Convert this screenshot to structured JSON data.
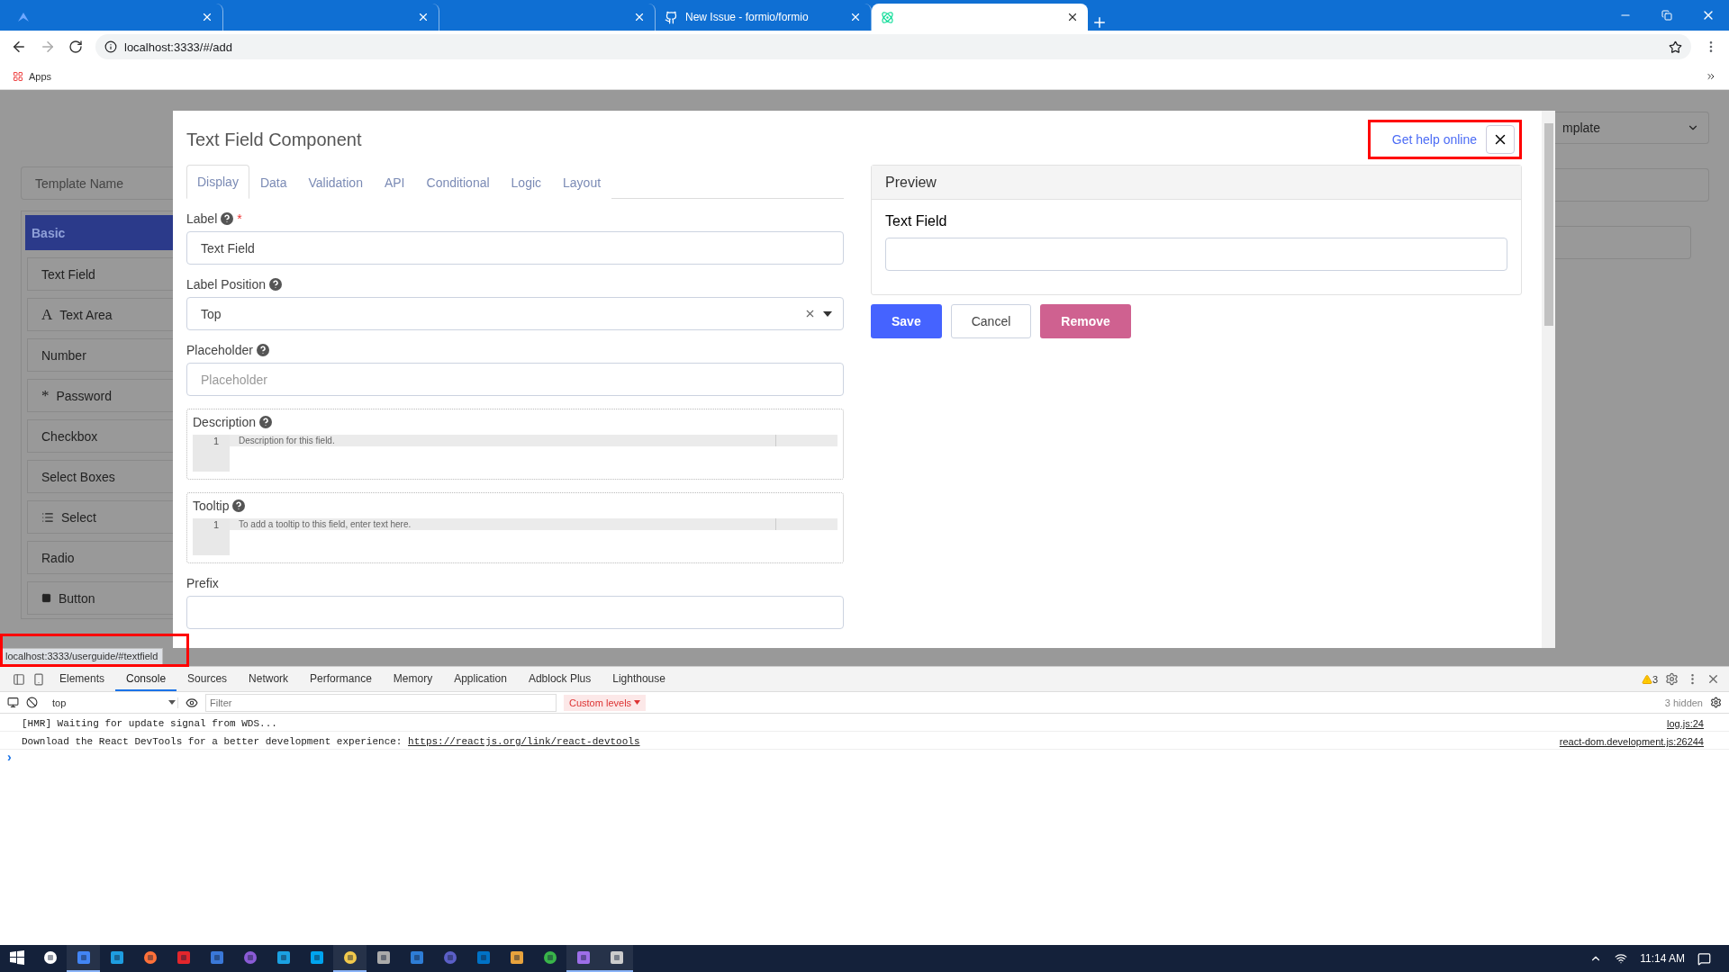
{
  "browser": {
    "tabs": [
      {
        "selected": false
      },
      {
        "selected": false
      },
      {
        "selected": false
      },
      {
        "title": "New Issue - formio/formio",
        "selected": false
      },
      {
        "selected": true
      }
    ],
    "address": "localhost:3333/#/add",
    "bookmarks": [
      "Apps"
    ]
  },
  "page": {
    "template_name_placeholder": "Template Name",
    "template_select": "mplate",
    "sidebar": {
      "group": "Basic",
      "items": [
        {
          "label": "Text Field",
          "kind": "plain"
        },
        {
          "label": "Text Area",
          "kind": "glyph",
          "glyph": "A"
        },
        {
          "label": "Number",
          "kind": "plain"
        },
        {
          "label": "Password",
          "kind": "glyph",
          "glyph": "*"
        },
        {
          "label": "Checkbox",
          "kind": "plain"
        },
        {
          "label": "Select Boxes",
          "kind": "plain"
        },
        {
          "label": "Select",
          "kind": "list"
        },
        {
          "label": "Radio",
          "kind": "plain"
        },
        {
          "label": "Button",
          "kind": "stop"
        }
      ]
    }
  },
  "modal": {
    "title": "Text Field Component",
    "help_link": "Get help online",
    "tabs": [
      {
        "label": "Display",
        "selected": true
      },
      {
        "label": "Data",
        "selected": false
      },
      {
        "label": "Validation",
        "selected": false
      },
      {
        "label": "API",
        "selected": false
      },
      {
        "label": "Conditional",
        "selected": false
      },
      {
        "label": "Logic",
        "selected": false
      },
      {
        "label": "Layout",
        "selected": false
      }
    ],
    "fields": [
      {
        "kind": "input",
        "label": "Label",
        "help": true,
        "required_mark": "*",
        "value": "Text Field"
      },
      {
        "kind": "select",
        "label": "Label Position",
        "help": true,
        "value": "Top"
      },
      {
        "kind": "input",
        "label": "Placeholder",
        "help": true,
        "placeholder": "Placeholder"
      },
      {
        "kind": "editor",
        "label": "Description",
        "help": true,
        "line": "1",
        "placeholder": "Description for this field."
      },
      {
        "kind": "editor",
        "label": "Tooltip",
        "help": true,
        "line": "1",
        "placeholder": "To add a tooltip to this field, enter text here."
      },
      {
        "kind": "input",
        "label": "Prefix",
        "help": false
      }
    ],
    "preview": {
      "title": "Preview",
      "label": "Text Field"
    },
    "buttons": [
      {
        "label": "Save",
        "kind": "primary"
      },
      {
        "label": "Cancel",
        "kind": "secondary"
      },
      {
        "label": "Remove",
        "kind": "danger"
      }
    ]
  },
  "status_url": "localhost:3333/userguide/#textfield",
  "devtools": {
    "tabs": [
      {
        "label": "Elements",
        "selected": false
      },
      {
        "label": "Console",
        "selected": true
      },
      {
        "label": "Sources",
        "selected": false
      },
      {
        "label": "Network",
        "selected": false
      },
      {
        "label": "Performance",
        "selected": false
      },
      {
        "label": "Memory",
        "selected": false
      },
      {
        "label": "Application",
        "selected": false
      },
      {
        "label": "Adblock Plus",
        "selected": false
      },
      {
        "label": "Lighthouse",
        "selected": false
      }
    ],
    "warnings": "3",
    "context": "top",
    "filter_placeholder": "Filter",
    "levels": "Custom levels",
    "hidden": "3 hidden",
    "messages": [
      {
        "text": "[HMR] Waiting for update signal from WDS...",
        "source": "log.js:24"
      },
      {
        "text": "Download the React DevTools for a better development experience: ",
        "link": "https://reactjs.org/link/react-devtools",
        "source": "react-dom.development.js:26244"
      }
    ],
    "prompt": "›"
  },
  "taskbar": {
    "apps": [
      {
        "running": false
      },
      {
        "running": true
      },
      {
        "running": false
      },
      {
        "running": false
      },
      {
        "running": false
      },
      {
        "running": false
      },
      {
        "running": false
      },
      {
        "running": false
      },
      {
        "running": false
      },
      {
        "running": true
      },
      {
        "running": false
      },
      {
        "running": false
      },
      {
        "running": false
      },
      {
        "running": false
      },
      {
        "running": false
      },
      {
        "running": false
      },
      {
        "running": true
      },
      {
        "running": true
      }
    ],
    "time": "11:14 AM"
  }
}
